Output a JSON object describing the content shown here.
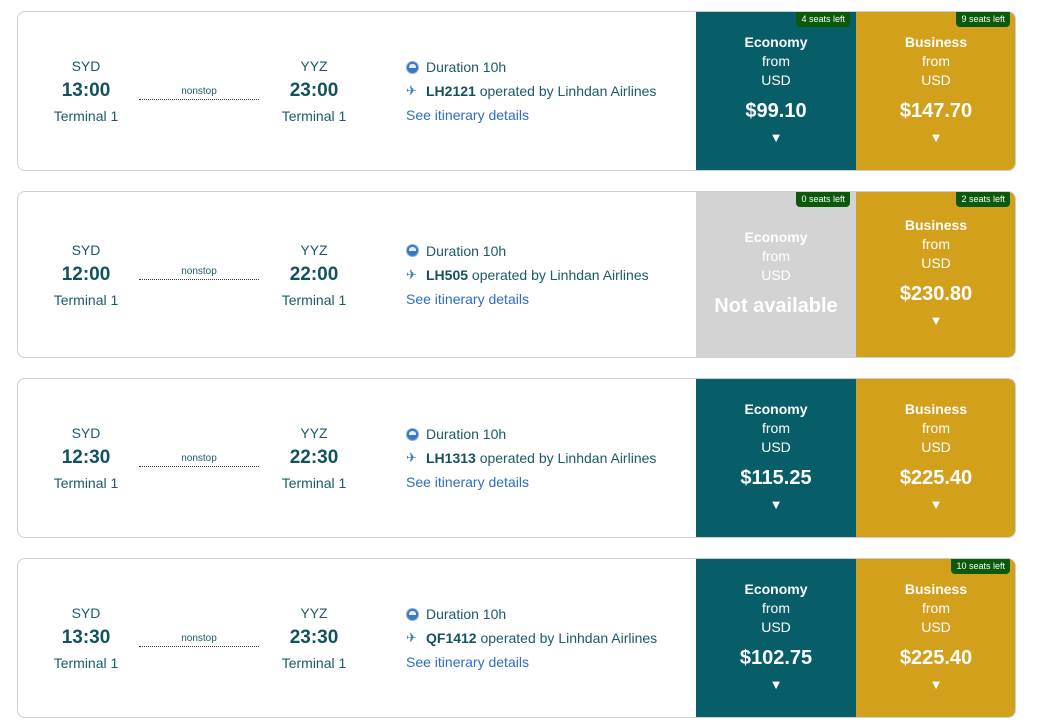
{
  "common": {
    "nonstop": "nonstop",
    "duration": "Duration 10h",
    "operated": "operated by Linhdan Airlines",
    "details_link": "See itinerary details",
    "economy": "Economy",
    "business": "Business",
    "from": "from",
    "currency": "USD",
    "not_available": "Not available",
    "arrow": "▼"
  },
  "colors": {
    "economy": "#075e69",
    "business": "#d3a01b",
    "unavailable": "#d3d3d3",
    "seats_badge": "#0a5a0a"
  },
  "icons": {
    "duration": "clock-icon",
    "flight": "airplane-icon",
    "expand": "caret-down-icon"
  },
  "flights": [
    {
      "dep_code": "SYD",
      "dep_time": "13:00",
      "dep_terminal": "Terminal 1",
      "arr_code": "YYZ",
      "arr_time": "23:00",
      "arr_terminal": "Terminal 1",
      "flight_no": "LH2121",
      "economy": {
        "seats_left": "4 seats left",
        "price": "$99.10"
      },
      "business": {
        "seats_left": "9 seats left",
        "price": "$147.70"
      }
    },
    {
      "dep_code": "SYD",
      "dep_time": "12:00",
      "dep_terminal": "Terminal 1",
      "arr_code": "YYZ",
      "arr_time": "22:00",
      "arr_terminal": "Terminal 1",
      "flight_no": "LH505",
      "economy": {
        "seats_left": "0 seats left",
        "price": null
      },
      "business": {
        "seats_left": "2 seats left",
        "price": "$230.80"
      }
    },
    {
      "dep_code": "SYD",
      "dep_time": "12:30",
      "dep_terminal": "Terminal 1",
      "arr_code": "YYZ",
      "arr_time": "22:30",
      "arr_terminal": "Terminal 1",
      "flight_no": "LH1313",
      "economy": {
        "seats_left": null,
        "price": "$115.25"
      },
      "business": {
        "seats_left": null,
        "price": "$225.40"
      }
    },
    {
      "dep_code": "SYD",
      "dep_time": "13:30",
      "dep_terminal": "Terminal 1",
      "arr_code": "YYZ",
      "arr_time": "23:30",
      "arr_terminal": "Terminal 1",
      "flight_no": "QF1412",
      "economy": {
        "seats_left": null,
        "price": "$102.75"
      },
      "business": {
        "seats_left": "10 seats left",
        "price": "$225.40"
      }
    }
  ]
}
